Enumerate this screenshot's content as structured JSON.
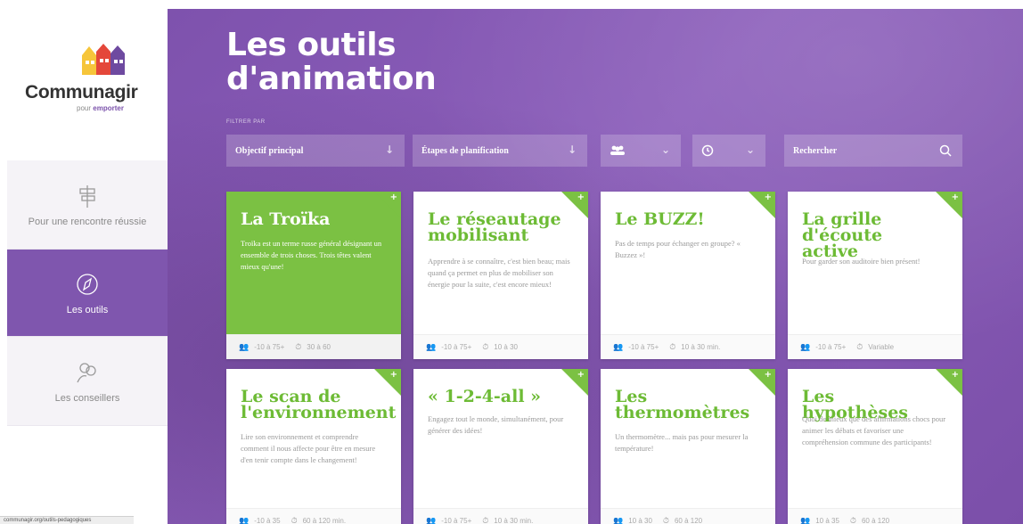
{
  "brand": {
    "name": "Communagir",
    "tagline_prefix": "pour",
    "tagline_suffix": "emporter"
  },
  "sidebar": {
    "items": [
      {
        "label": "Pour une rencontre réussie",
        "icon": "signpost-icon",
        "active": false
      },
      {
        "label": "Les outils",
        "icon": "compass-icon",
        "active": true
      },
      {
        "label": "Les conseillers",
        "icon": "people-icon",
        "active": false
      }
    ]
  },
  "header": {
    "title_line1": "Les outils",
    "title_line2": "d'animation",
    "filter_label": "FILTRER PAR"
  },
  "filters": [
    {
      "label": "Objectif principal",
      "icon": "chevron-down-icon"
    },
    {
      "label": "Étapes de planification",
      "icon": "chevron-down-icon"
    },
    {
      "label": "",
      "icon": "group-icon"
    },
    {
      "label": "",
      "icon": "clock-icon"
    },
    {
      "label": "Rechercher",
      "icon": "search-icon"
    }
  ],
  "cards": [
    {
      "title": "La Troïka",
      "desc": "Troïka est un terme russe général désignant un ensemble de trois choses. Trois têtes valent mieux qu'une!",
      "participants": "-10 à 75+",
      "duration": "30 à 60"
    },
    {
      "title": "Le réseautage mobilisant",
      "desc": "Apprendre à se connaître, c'est bien beau; mais quand ça permet en plus de mobiliser son énergie pour la suite, c'est encore mieux!",
      "participants": "-10 à 75+",
      "duration": "10 à 30"
    },
    {
      "title": "Le BUZZ!",
      "desc": "Pas de temps pour échanger en groupe? « Buzzez »!",
      "participants": "-10 à 75+",
      "duration": "10 à 30 min."
    },
    {
      "title": "La grille d'écoute active",
      "desc": "Pour garder son auditoire bien présent!",
      "participants": "-10 à 75+",
      "duration": "Variable"
    },
    {
      "title": "Le scan de l'environnement",
      "desc": "Lire son environnement et comprendre comment il nous affecte pour être en mesure d'en tenir compte dans le changement!",
      "participants": "-10 à 35",
      "duration": "60 à 120 min."
    },
    {
      "title": "« 1-2-4-all »",
      "desc": "Engagez tout le monde, simultanément, pour générer des idées!",
      "participants": "-10 à 75+",
      "duration": "10 à 30 min."
    },
    {
      "title": "Les thermomètres",
      "desc": "Un thermomètre... mais pas pour mesurer la température!",
      "participants": "10 à 30",
      "duration": "60 à 120"
    },
    {
      "title": "Les hypothèses",
      "desc": "Quoi de mieux que des affirmations chocs pour animer les débats et favoriser une compréhension commune des participants!",
      "participants": "10 à 35",
      "duration": "60 à 120"
    }
  ],
  "status_text": "communagir.org/outils-pedagogiques",
  "colors": {
    "accent_green": "#7bc143",
    "brand_purple": "#7f56ae"
  }
}
